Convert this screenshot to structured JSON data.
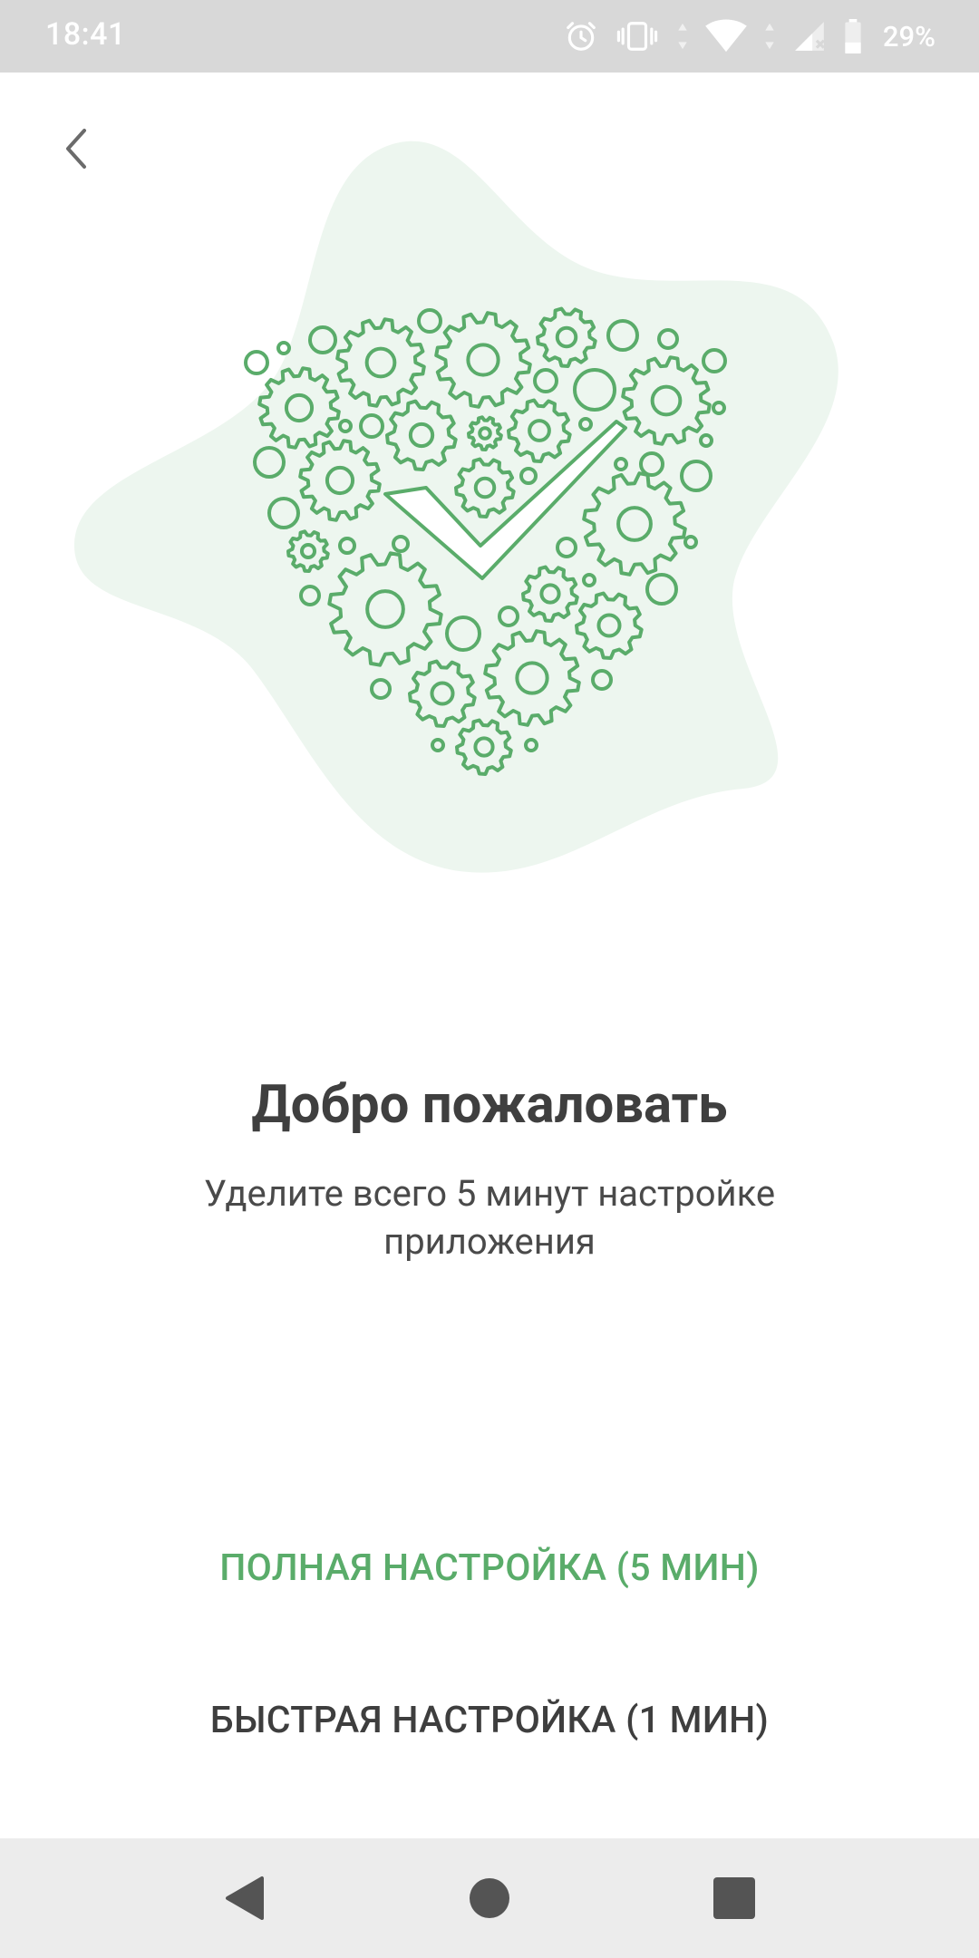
{
  "status_bar": {
    "time": "18:41",
    "battery_percent": "29%",
    "icons": [
      "alarm-icon",
      "vibrate-icon",
      "wifi-icon",
      "signal-icon",
      "battery-icon"
    ]
  },
  "header": {
    "back_icon": "chevron-left-icon"
  },
  "welcome": {
    "title": "Добро пожаловать",
    "subtitle": "Уделите всего 5 минут настройке приложения"
  },
  "actions": {
    "full_setup_label": "ПОЛНАЯ НАСТРОЙКА (5 МИН)",
    "quick_setup_label": "БЫСТРАЯ НАСТРОЙКА (1 МИН)"
  },
  "navigation": {
    "back_icon": "nav-back-icon",
    "home_icon": "nav-home-icon",
    "recents_icon": "nav-recents-icon"
  },
  "colors": {
    "accent": "#5aac6a",
    "blob": "#edf6ef",
    "status_bar": "#d8d8d8",
    "nav_bar": "#ececec"
  }
}
